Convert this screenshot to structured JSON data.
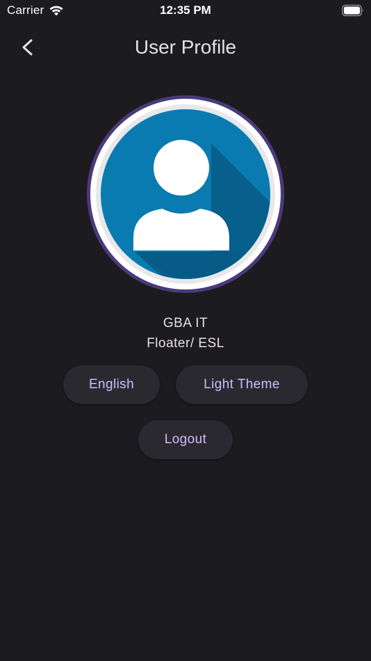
{
  "status_bar": {
    "carrier": "Carrier",
    "time": "12:35 PM",
    "wifi_icon": "wifi-icon",
    "battery_icon": "battery-icon"
  },
  "app_bar": {
    "title": "User Profile",
    "back_icon": "chevron-left-icon"
  },
  "profile": {
    "avatar_icon": "user-avatar-icon",
    "name": "GBA IT",
    "role": "Floater/ ESL"
  },
  "actions": {
    "language_label": "English",
    "theme_label": "Light Theme",
    "logout_label": "Logout"
  },
  "colors": {
    "background": "#1c1b1f",
    "button_bg": "#2a2930",
    "button_text": "#d0bcff",
    "avatar_blue": "#0a7bb0",
    "avatar_ring": "#4a3a7c"
  }
}
